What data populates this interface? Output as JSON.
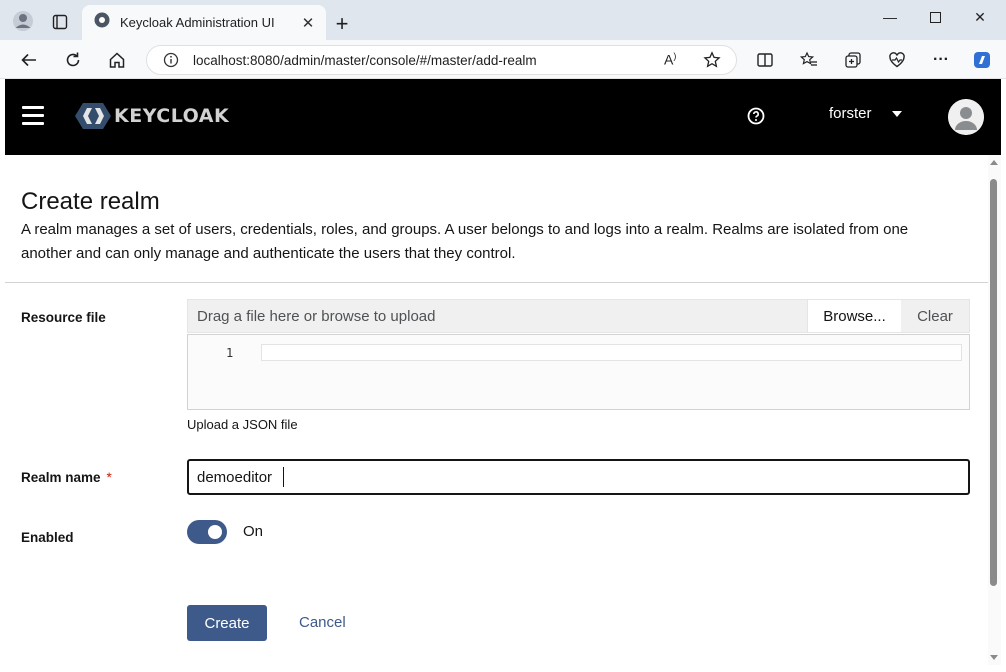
{
  "browser": {
    "tab_title": "Keycloak Administration UI",
    "url": "localhost:8080/admin/master/console/#/master/add-realm",
    "tab_favicon_icon": "keycloak-favicon-icon"
  },
  "masthead": {
    "logo_text": "KEYCLOAK",
    "username": "forster",
    "background": "#000000"
  },
  "page": {
    "title": "Create realm",
    "description": "A realm manages a set of users, credentials, roles, and groups. A user belongs to and logs into a realm. Realms are isolated from one another and can only manage and authenticate the users that they control."
  },
  "form": {
    "resource_file_label": "Resource file",
    "upload_placeholder": "Drag a file here or browse to upload",
    "browse_label": "Browse...",
    "clear_label": "Clear",
    "code_line_number": "1",
    "upload_helper": "Upload a JSON file",
    "realm_name_label": "Realm name",
    "required_marker": "*",
    "realm_name_value": "demoeditor",
    "enabled_label": "Enabled",
    "enabled_state": "On",
    "enabled": true,
    "create_label": "Create",
    "cancel_label": "Cancel"
  },
  "colors": {
    "primary": "#3e5a8a",
    "required": "#c9190b"
  }
}
